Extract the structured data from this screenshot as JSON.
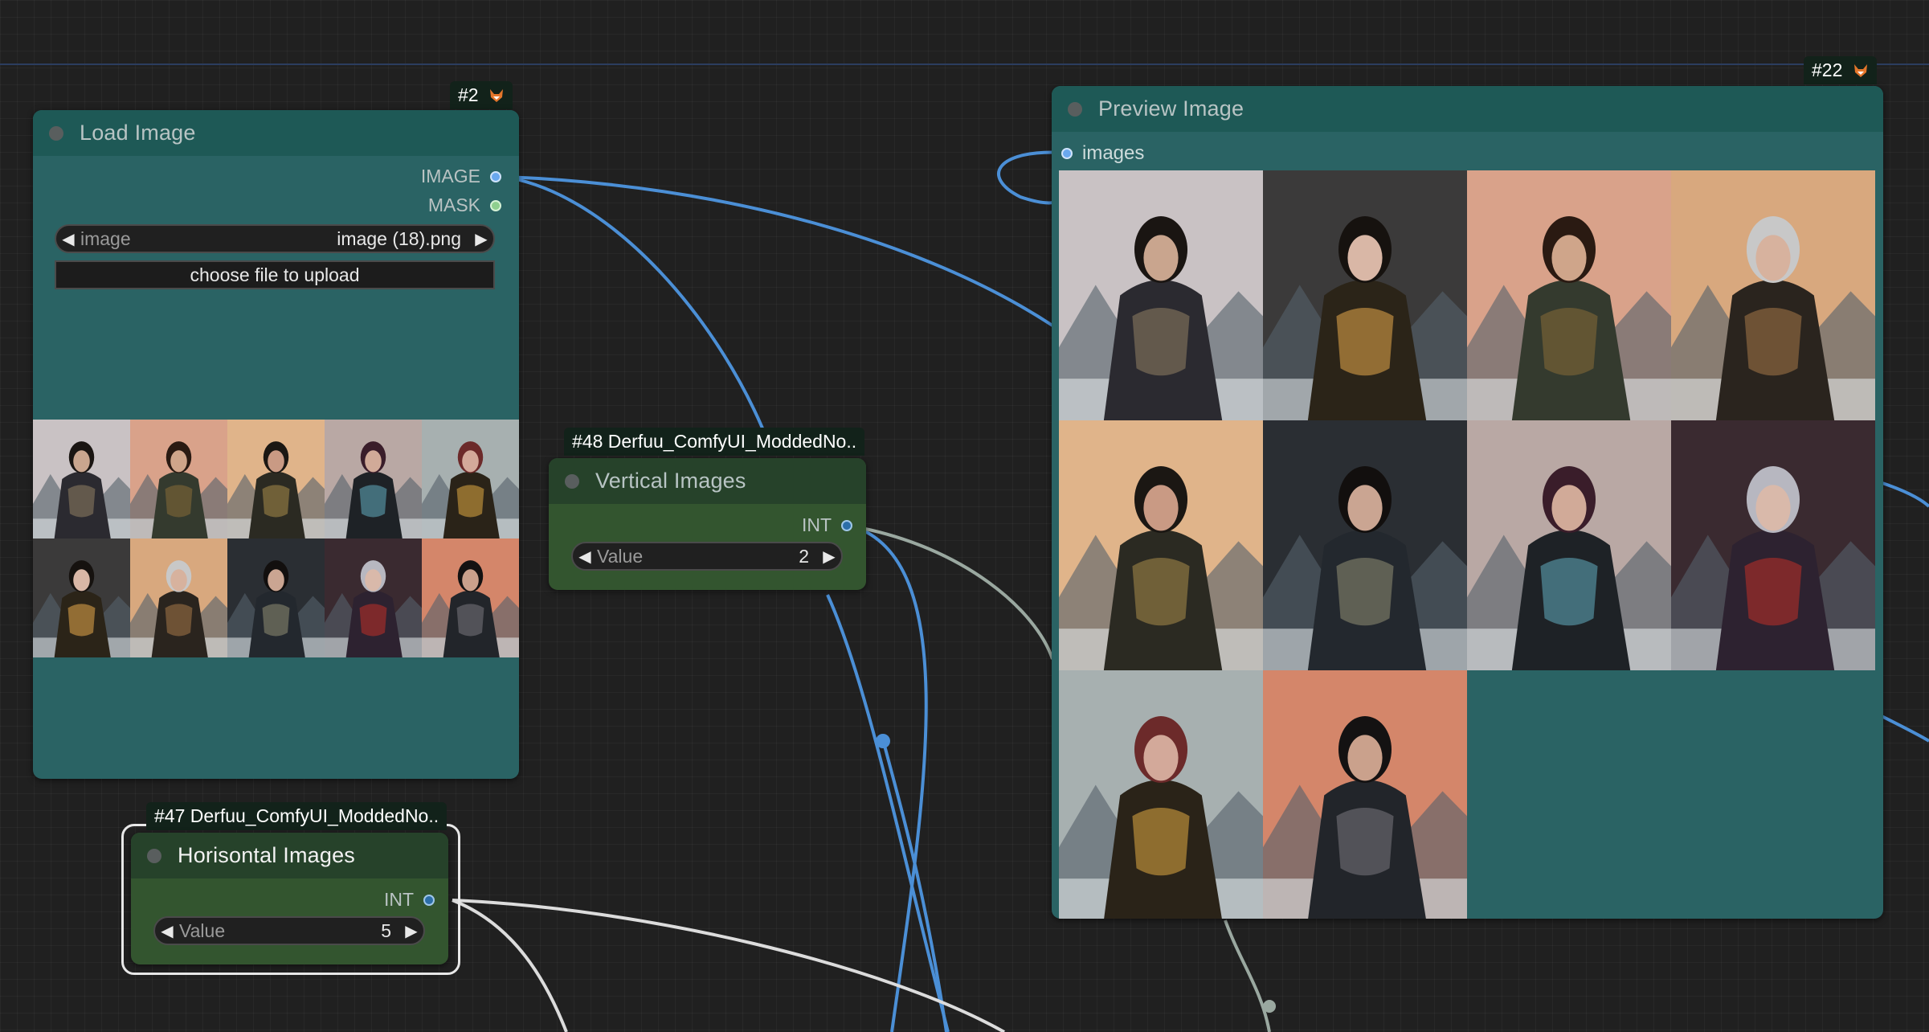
{
  "nodes": {
    "load_image": {
      "badge": "#2",
      "title": "Load Image",
      "outputs": [
        "IMAGE",
        "MASK"
      ],
      "image_widget": {
        "label": "image",
        "value": "image (18).png"
      },
      "upload_button": "choose file to upload"
    },
    "vertical_images": {
      "badge": "#48 Derfuu_ComfyUI_ModdedNo..",
      "title": "Vertical Images",
      "output": "INT",
      "widget": {
        "label": "Value",
        "value": "2"
      }
    },
    "horizontal_images": {
      "badge": "#47 Derfuu_ComfyUI_ModdedNo..",
      "title": "Horisontal Images",
      "output": "INT",
      "widget": {
        "label": "Value",
        "value": "5"
      }
    },
    "preview_image": {
      "badge": "#22",
      "title": "Preview Image",
      "input": "images"
    }
  },
  "colors": {
    "node_teal": "#2a6364",
    "node_green": "#33552f",
    "image_wire": "#4b8fd6",
    "int_wire": "#9aa8a0"
  },
  "gallery_tiles": [
    {
      "sky": "#c9c2c4",
      "cloak": "#2b2a30",
      "hair": "#1a1512",
      "skin": "#c9a58e",
      "accent": "#6d6251"
    },
    {
      "sky": "#3b3a3a",
      "cloak": "#2b2418",
      "hair": "#16120f",
      "skin": "#d9b7a6",
      "accent": "#a47a3a"
    },
    {
      "sky": "#d9a28a",
      "cloak": "#343a2e",
      "hair": "#2a1a12",
      "skin": "#cfa58a",
      "accent": "#6b5a34"
    },
    {
      "sky": "#d8a87e",
      "cloak": "#2a241e",
      "hair": "#c8c8c8",
      "skin": "#d7b29e",
      "accent": "#7a5a3a"
    },
    {
      "sky": "#e0b48a",
      "cloak": "#2b2a22",
      "hair": "#1b1713",
      "skin": "#c99a84",
      "accent": "#7c6a3c"
    },
    {
      "sky": "#2a2e33",
      "cloak": "#23282e",
      "hair": "#120f0e",
      "skin": "#caa592",
      "accent": "#6a6a5a"
    },
    {
      "sky": "#b9a8a4",
      "cloak": "#1e2226",
      "hair": "#3a1d2a",
      "skin": "#d1aa98",
      "accent": "#4a7b8a"
    },
    {
      "sky": "#3a2a30",
      "cloak": "#2d2230",
      "hair": "#b7b7c0",
      "skin": "#d9b9aa",
      "accent": "#8c2a2a"
    },
    {
      "sky": "#a7b0b0",
      "cloak": "#2a2318",
      "hair": "#6c2a2a",
      "skin": "#d3a99a",
      "accent": "#a07a34"
    },
    {
      "sky": "#d4866a",
      "cloak": "#22252a",
      "hair": "#141212",
      "skin": "#caa18c",
      "accent": "#5a5a60"
    }
  ]
}
